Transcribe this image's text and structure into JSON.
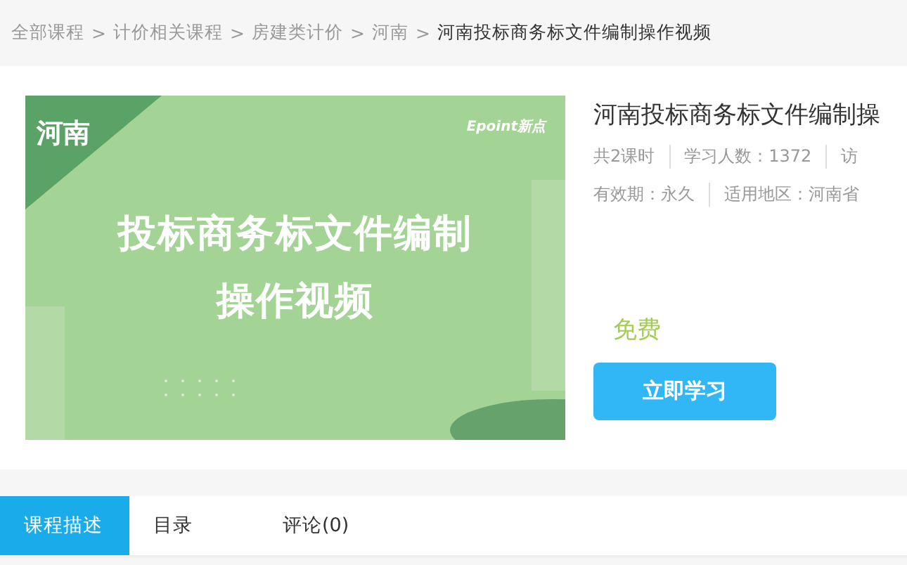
{
  "breadcrumb": [
    {
      "label": "全部课程",
      "current": false
    },
    {
      "label": "计价相关课程",
      "current": false
    },
    {
      "label": "房建类计价",
      "current": false
    },
    {
      "label": "河南",
      "current": false
    },
    {
      "label": "河南投标商务标文件编制操作视频",
      "current": true
    }
  ],
  "breadcrumb_separator": ">",
  "cover": {
    "corner_label": "河南",
    "logo": "Epoint新点",
    "headline": [
      "投标商务标文件编制",
      "操作视频"
    ]
  },
  "course": {
    "title": "河南投标商务标文件编制操",
    "meta_rows": [
      [
        "共2课时",
        "学习人数：1372",
        "访"
      ],
      [
        "有效期：永久",
        "适用地区：河南省"
      ]
    ],
    "price": "免费",
    "action": "立即学习"
  },
  "tabs": [
    {
      "label": "课程描述",
      "selected": true
    },
    {
      "label": "目录",
      "selected": false
    },
    {
      "label": "评论(0)",
      "selected": false
    }
  ]
}
